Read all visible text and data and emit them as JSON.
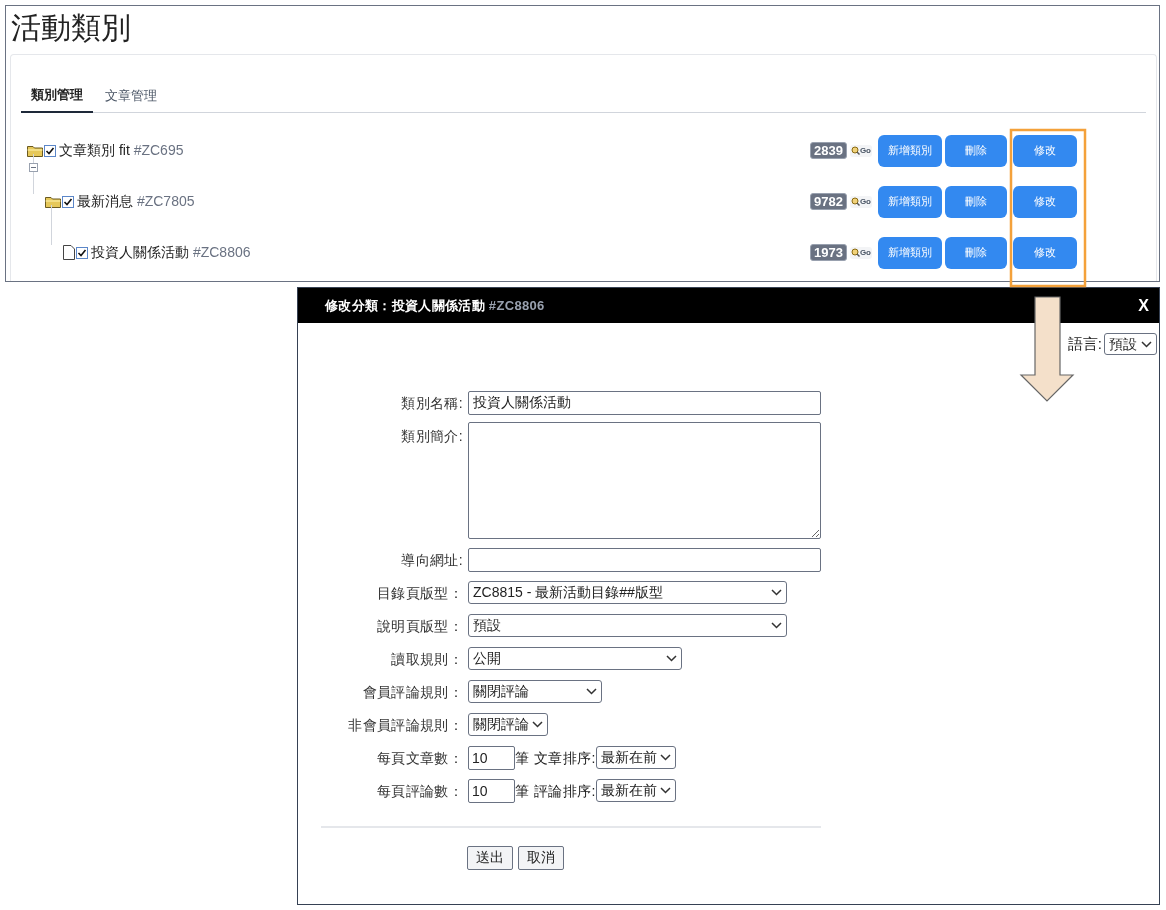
{
  "page_title": "活動類別",
  "tabs": [
    {
      "label": "類別管理",
      "selected": true
    },
    {
      "label": "文章管理",
      "selected": false
    }
  ],
  "tree": [
    {
      "kind": "folder",
      "label": "文章類別 fit",
      "code": "#ZC695",
      "checked": true,
      "count": "2839",
      "go": "Go",
      "actions": [
        "新增類別",
        "刪除",
        "修改"
      ],
      "children": [
        {
          "kind": "folder",
          "label": "最新消息",
          "code": "#ZC7805",
          "checked": true,
          "expanded": true,
          "count": "9782",
          "go": "Go",
          "actions": [
            "新增類別",
            "刪除",
            "修改"
          ],
          "children": [
            {
              "kind": "file",
              "label": "投資人關係活動",
              "code": "#ZC8806",
              "checked": true,
              "count": "1973",
              "go": "Go",
              "actions": [
                "新增類別",
                "刪除",
                "修改"
              ]
            }
          ]
        }
      ]
    }
  ],
  "dialog": {
    "title": "修改分類：投資人關係活動",
    "code": "#ZC8806",
    "close": "X",
    "language_label": "語言:",
    "language_value": "預設",
    "fields": [
      {
        "kind": "text",
        "label": "類別名稱:",
        "value": "投資人關係活動"
      },
      {
        "kind": "textarea",
        "label": "類別簡介:"
      },
      {
        "kind": "text",
        "label": "導向網址:"
      },
      {
        "kind": "select",
        "label": "目錄頁版型：",
        "value": "ZC8815 - 最新活動目錄##版型"
      },
      {
        "kind": "select",
        "label": "說明頁版型：",
        "value": "預設"
      },
      {
        "kind": "select",
        "label": "讀取規則：",
        "value": "公開"
      },
      {
        "kind": "select",
        "label": "會員評論規則：",
        "value": "關閉評論"
      },
      {
        "kind": "select",
        "label": "非會員評論規則：",
        "value": "關閉評論"
      },
      {
        "kind": "count",
        "label": "每頁文章數：",
        "value": "10",
        "unit": "筆",
        "sort_label": "文章排序:",
        "sort_value": "最新在前"
      },
      {
        "kind": "count",
        "label": "每頁評論數：",
        "value": "10",
        "unit": "筆",
        "sort_label": "評論排序:",
        "sort_value": "最新在前"
      }
    ],
    "buttons": [
      "送出",
      "取消"
    ]
  }
}
